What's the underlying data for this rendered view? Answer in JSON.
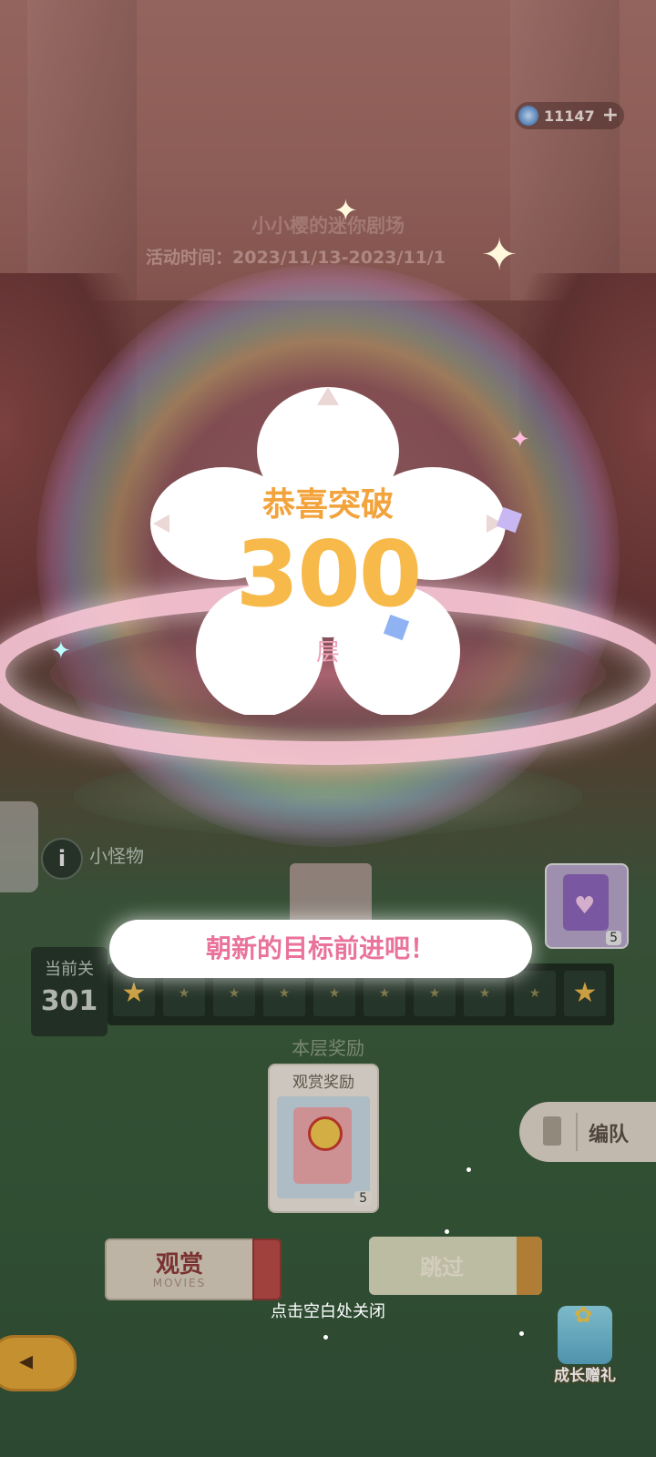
{
  "currency": {
    "icon": "gem-icon",
    "amount": "11147",
    "plus": "+"
  },
  "event": {
    "title": "小小樱的迷你剧场",
    "time": "活动时间：2023/11/13-2023/11/1"
  },
  "popup": {
    "title": "恭喜突破",
    "number": "300",
    "unit": "层",
    "message": "朝新的目标前进吧！",
    "close_hint": "点击空白处关闭"
  },
  "monster": {
    "label": "小怪物"
  },
  "level": {
    "label": "当前关",
    "value": "301"
  },
  "level_strip": {
    "cells": [
      "★",
      "★",
      "★",
      "★",
      "★",
      "★",
      "★",
      "★",
      "★",
      "★"
    ]
  },
  "floor_reward": {
    "header": "本层奖励",
    "card_title": "观赏奖励",
    "count": "5"
  },
  "next_reward": {
    "count": "5"
  },
  "team": {
    "label": "编队"
  },
  "buttons": {
    "watch": "观赏",
    "watch_sub": "MOVIES",
    "skip": "跳过"
  },
  "gift": {
    "label": "成长赠礼"
  },
  "colors": {
    "accent_orange": "#f7b94a",
    "message_pink": "#e9739a",
    "back_button": "#e1a436"
  }
}
